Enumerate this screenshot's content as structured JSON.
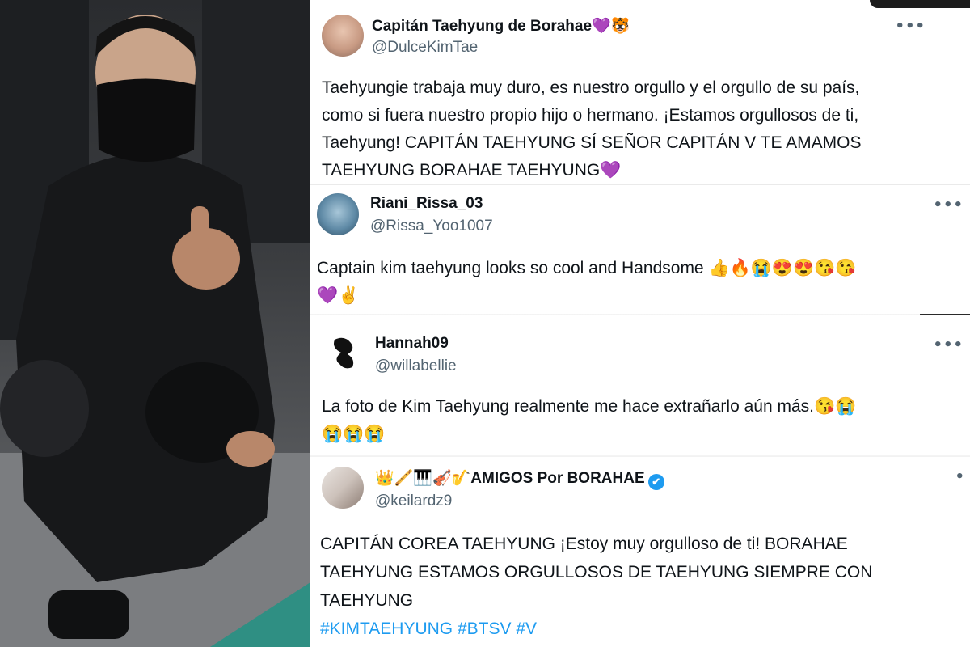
{
  "photo": {
    "alt_icon": "soldier-photo"
  },
  "tweets": [
    {
      "name": "Capitán Taehyung de Borahae💜🐯",
      "handle": "@DulceKimTae",
      "more": "•••",
      "lines": [
        "Taehyungie trabaja muy duro, es nuestro orgullo y el orgullo de su país,",
        "como si fuera nuestro propio hijo o hermano. ¡Estamos orgullosos de ti,",
        "Taehyung! CAPITÁN TAEHYUNG SÍ SEÑOR CAPITÁN V TE AMAMOS",
        "TAEHYUNG BORAHAE TAEHYUNG💜"
      ]
    },
    {
      "name": "Riani_Rissa_03",
      "handle": "@Rissa_Yoo1007",
      "more": "•••",
      "lines": [
        "Captain kim taehyung looks so cool and Handsome 👍🔥😭😍😍😘😘",
        "💜✌"
      ]
    },
    {
      "name": "Hannah09",
      "handle": "@willabellie",
      "more": "•••",
      "lines": [
        "La foto de Kim Taehyung realmente me hace extrañarlo aún más.😘😭",
        "😭😭😭"
      ]
    },
    {
      "name": "👑🪈🎹🎻🎷AMIGOS Por    BORAHAE",
      "handle": "@keilardz9",
      "more": "•",
      "lines": [
        "CAPITÁN COREA TAEHYUNG ¡Estoy muy orgulloso de ti! BORAHAE",
        "TAEHYUNG ESTAMOS ORGULLOSOS DE TAEHYUNG SIEMPRE CON",
        "TAEHYUNG"
      ],
      "hashtags": " #KIMTAEHYUNG #BTSV #V",
      "verified_icon": "✔"
    }
  ]
}
